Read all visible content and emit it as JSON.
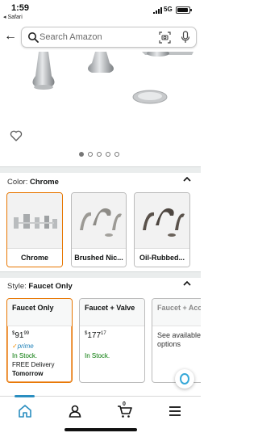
{
  "status_bar": {
    "time": "1:59",
    "back_app": "◂ Safari",
    "network": "5G"
  },
  "search": {
    "placeholder": "Search Amazon"
  },
  "carousel": {
    "total_dots": 5,
    "active_index": 0
  },
  "color_section": {
    "label": "Color:",
    "selected": "Chrome",
    "options": [
      {
        "name": "Chrome",
        "selected": true
      },
      {
        "name": "Brushed Nic...",
        "selected": false
      },
      {
        "name": "Oil-Rubbed...",
        "selected": false
      }
    ]
  },
  "style_section": {
    "label": "Style:",
    "selected": "Faucet Only",
    "options": [
      {
        "name": "Faucet Only",
        "price_whole": "91",
        "price_fraction": "99",
        "currency": "$",
        "prime": "prime",
        "stock": "In Stock.",
        "delivery_line1": "FREE Delivery",
        "delivery_line2": "Tomorrow"
      },
      {
        "name": "Faucet + Valve",
        "price_whole": "177",
        "price_fraction": "17",
        "currency": "$",
        "stock": "In Stock."
      },
      {
        "name": "Faucet + Acce",
        "availability": "See available options"
      }
    ]
  },
  "bottom_nav": {
    "cart_count": "0"
  },
  "colors": {
    "accent_orange": "#e77600",
    "in_stock_green": "#007600",
    "prime_blue": "#1f80b8",
    "nav_active": "#2a8ec0"
  }
}
